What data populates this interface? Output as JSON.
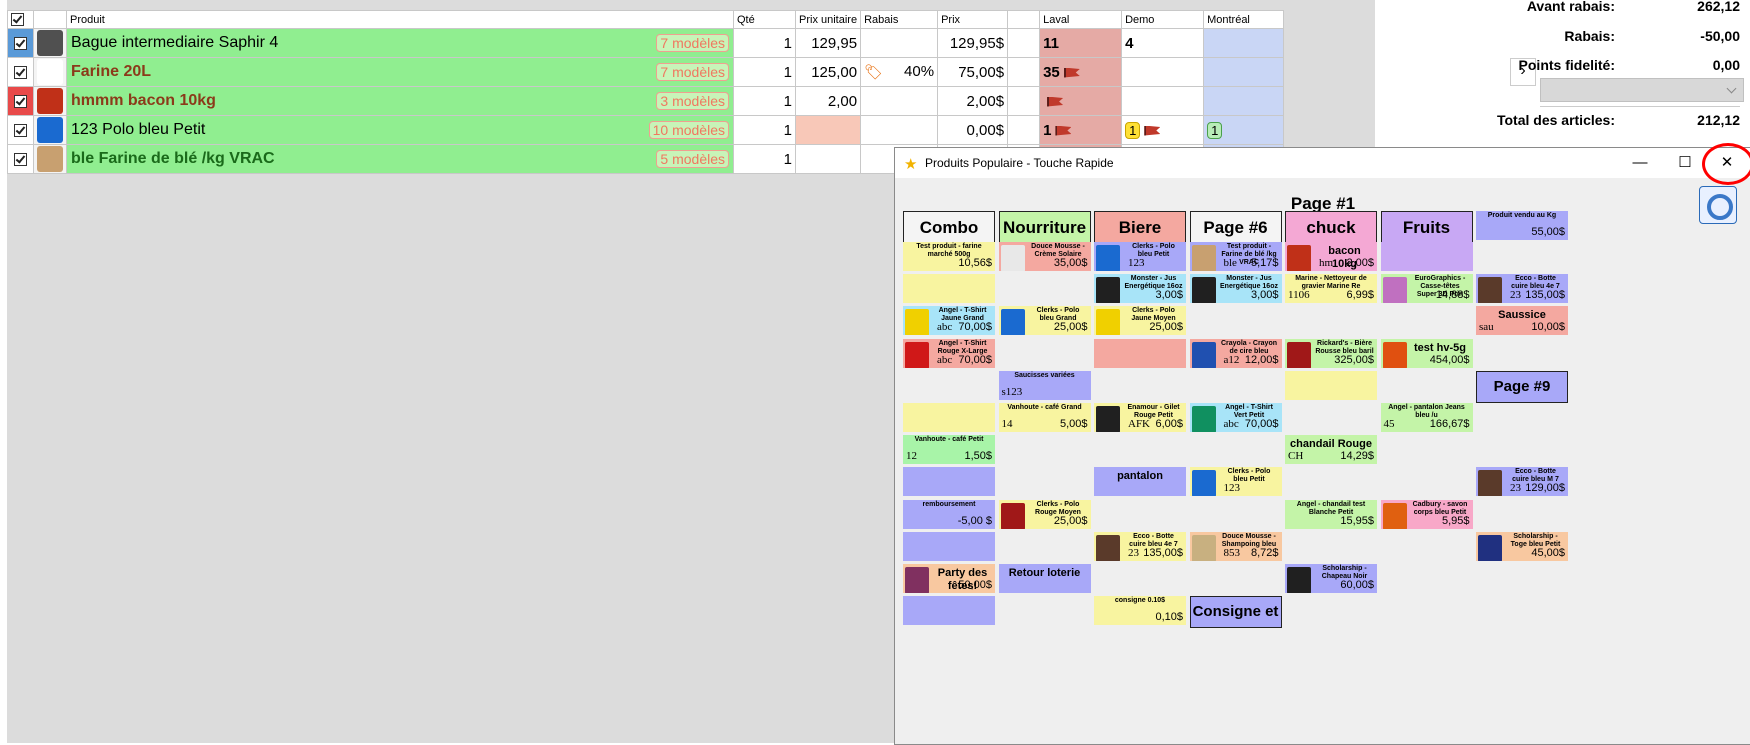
{
  "table": {
    "headers": {
      "produit": "Produit",
      "qte": "Qté",
      "prix_unitaire": "Prix unitaire",
      "rabais": "Rabais",
      "prix": "Prix",
      "laval": "Laval",
      "demo": "Demo",
      "montreal": "Montréal"
    },
    "rows": [
      {
        "name": "Bague intermediaire Saphir 4",
        "bold": false,
        "color": "#000000",
        "models": "7 modèles",
        "qty": "1",
        "unit": "129,95",
        "rabais": "",
        "prix": "129,95$",
        "laval": "11",
        "demo": "4",
        "montreal": ""
      },
      {
        "name": "Farine 20L",
        "bold": true,
        "color": "#8b3a1a",
        "models": "7 modèles",
        "qty": "1",
        "unit": "125,00",
        "rabais": "40%",
        "prix": "75,00$",
        "laval": "35",
        "demo": "",
        "montreal": ""
      },
      {
        "name": "hmmm bacon 10kg",
        "bold": true,
        "color": "#8b3a1a",
        "models": "3 modèles",
        "qty": "1",
        "unit": "2,00",
        "rabais": "",
        "prix": "2,00$",
        "laval": "",
        "demo": "",
        "montreal": ""
      },
      {
        "name": "123 Polo bleu Petit",
        "bold": false,
        "color": "#000000",
        "models": "10 modèles",
        "qty": "1",
        "unit": "",
        "rabais": "",
        "prix": "0,00$",
        "laval": "1",
        "demo": "1",
        "montreal": "1"
      },
      {
        "name": "ble Farine de blé /kg VRAC",
        "bold": true,
        "color": "#1a6a1a",
        "models": "5 modèles",
        "qty": "1",
        "unit": "",
        "rabais": "",
        "prix": "",
        "laval": "",
        "demo": "",
        "montreal": ""
      }
    ]
  },
  "totals": {
    "avant_rabais_label": "Avant rabais:",
    "avant_rabais": "262,12",
    "rabais_label": "Rabais:",
    "rabais": "-50,00",
    "points_label": "Points fidelité:",
    "points": "0,00",
    "total_label": "Total des articles:",
    "total": "212,12"
  },
  "popup": {
    "title": "Produits Populaire - Touche Rapide",
    "page": "Page #1",
    "headers": [
      "Combo",
      "Nourriture",
      "Biere",
      "Page #6",
      "chuck",
      "Fruits"
    ],
    "tiles": [
      {
        "col": 6,
        "row": 0,
        "name": "Produit vendu au Kg",
        "price": "55,00$",
        "color": "c-blu"
      },
      {
        "col": 0,
        "row": 1,
        "name": "Test produit - farine marché 500g",
        "price": "10,56$",
        "color": "c-yel"
      },
      {
        "col": 1,
        "row": 1,
        "name": "Douce Mousse - Crème Solaire",
        "price": "35,00$",
        "color": "c-pink",
        "img": "#e8e8e8"
      },
      {
        "col": 2,
        "row": 1,
        "name": "Clerks - Polo bleu Petit",
        "code": "123",
        "price": "",
        "color": "c-blu",
        "img": "#1a6ad0"
      },
      {
        "col": 3,
        "row": 1,
        "name": "Test produit - Farine de blé /kg VRAC",
        "code": "ble",
        "price": "5,17$",
        "color": "c-blu",
        "img": "#c8a070"
      },
      {
        "col": 4,
        "row": 1,
        "name": "bacon 10kg",
        "code": "hm",
        "price": "2,00$",
        "color": "c-mag",
        "img": "#c03018",
        "big": true
      },
      {
        "col": 5,
        "row": 1,
        "name": "",
        "price": "",
        "color": "c-pur"
      },
      {
        "col": 0,
        "row": 2,
        "name": "",
        "price": "",
        "color": "c-yel"
      },
      {
        "col": 2,
        "row": 2,
        "name": "Monster - Jus Energétique 16oz",
        "price": "3,00$",
        "color": "c-cyan",
        "img": "#202020"
      },
      {
        "col": 3,
        "row": 2,
        "name": "Monster - Jus Energétique 16oz",
        "price": "3,00$",
        "color": "c-cyan",
        "img": "#202020"
      },
      {
        "col": 4,
        "row": 2,
        "name": "Marine - Nettoyeur de gravier Marine Re",
        "code": "1106",
        "price": "6,99$",
        "color": "c-yel"
      },
      {
        "col": 5,
        "row": 2,
        "name": "EuroGraphics - Casse-têtes Super 3D Prin",
        "price": "14,88$",
        "color": "c-grn",
        "img": "#c070c0"
      },
      {
        "col": 6,
        "row": 2,
        "name": "Ecco - Botte cuire bleu 4e 7",
        "code": "23",
        "price": "135,00$",
        "color": "c-blu",
        "img": "#5a3a2a"
      },
      {
        "col": 0,
        "row": 3,
        "name": "Angel - T-Shirt Jaune Grand",
        "code": "abc",
        "price": "70,00$",
        "color": "c-cyan",
        "img": "#f0d000"
      },
      {
        "col": 1,
        "row": 3,
        "name": "Clerks - Polo bleu Grand",
        "price": "25,00$",
        "color": "c-yel",
        "img": "#1a6ad0"
      },
      {
        "col": 2,
        "row": 3,
        "name": "Clerks - Polo Jaune Moyen",
        "price": "25,00$",
        "color": "c-yel",
        "img": "#f0d000"
      },
      {
        "col": 6,
        "row": 3,
        "name": "Saussice",
        "code": "sau",
        "price": "10,00$",
        "color": "c-pink",
        "big": true
      },
      {
        "col": 0,
        "row": 4,
        "name": "Angel - T-Shirt Rouge X-Large",
        "code": "abc",
        "price": "70,00$",
        "color": "c-pink",
        "img": "#d01818"
      },
      {
        "col": 2,
        "row": 4,
        "name": "",
        "price": "",
        "color": "c-pink"
      },
      {
        "col": 3,
        "row": 4,
        "name": "Crayola - Crayon de cire bleu",
        "code": "a12",
        "price": "12,00$",
        "color": "c-pink",
        "img": "#2050b0"
      },
      {
        "col": 4,
        "row": 4,
        "name": "Rickard's - Bière Rousse bleu baril",
        "price": "325,00$",
        "color": "c-grn",
        "img": "#a01818"
      },
      {
        "col": 5,
        "row": 4,
        "name": "test hv-5g",
        "price": "454,00$",
        "color": "c-grn",
        "img": "#e05010",
        "big": true
      },
      {
        "col": 1,
        "row": 5,
        "name": "Saucisses variées",
        "code": "s123",
        "price": "",
        "color": "c-blu"
      },
      {
        "col": 4,
        "row": 5,
        "name": "",
        "price": "",
        "color": "c-yel"
      },
      {
        "col": 6,
        "row": 5,
        "name": "Page #9",
        "price": "",
        "color": "c-blu",
        "header": true
      },
      {
        "col": 0,
        "row": 6,
        "name": "",
        "price": "",
        "color": "c-yel"
      },
      {
        "col": 1,
        "row": 6,
        "name": "Vanhoute - café Grand",
        "code": "14",
        "price": "5,00$",
        "color": "c-yel"
      },
      {
        "col": 2,
        "row": 6,
        "name": "Enamour - Gilet Rouge Petit",
        "code": "AFK",
        "price": "6,00$",
        "color": "c-yel",
        "img": "#202020"
      },
      {
        "col": 3,
        "row": 6,
        "name": "Angel - T-Shirt Vert Petit",
        "code": "abc",
        "price": "70,00$",
        "color": "c-cyan",
        "img": "#109060"
      },
      {
        "col": 5,
        "row": 6,
        "name": "Angel - pantalon Jeans bleu /u",
        "code": "45",
        "price": "166,67$",
        "color": "c-grn"
      },
      {
        "col": 0,
        "row": 7,
        "name": "Vanhoute - café Petit",
        "code": "12",
        "price": "1,50$",
        "color": "c-lgrn"
      },
      {
        "col": 4,
        "row": 7,
        "name": "chandail Rouge",
        "code": "CH",
        "price": "14,29$",
        "color": "c-grn",
        "big": true
      },
      {
        "col": 0,
        "row": 8,
        "name": "",
        "price": "",
        "color": "c-blu"
      },
      {
        "col": 2,
        "row": 8,
        "name": "pantalon",
        "price": "",
        "color": "c-blu",
        "big": true
      },
      {
        "col": 3,
        "row": 8,
        "name": "Clerks - Polo bleu Petit",
        "code": "123",
        "price": "",
        "color": "c-yel",
        "img": "#1a6ad0"
      },
      {
        "col": 6,
        "row": 8,
        "name": "Ecco - Botte cuire bleu M 7",
        "code": "23",
        "price": "129,00$",
        "color": "c-blu",
        "img": "#5a3a2a"
      },
      {
        "col": 0,
        "row": 9,
        "name": "remboursement",
        "price": "-5,00 $",
        "color": "c-blu"
      },
      {
        "col": 1,
        "row": 9,
        "name": "Clerks - Polo Rouge Moyen",
        "price": "25,00$",
        "color": "c-yel",
        "img": "#a01818"
      },
      {
        "col": 4,
        "row": 9,
        "name": "Angel - chandail test Blanche Petit",
        "price": "15,95$",
        "color": "c-grn"
      },
      {
        "col": 5,
        "row": 9,
        "name": "Cadbury - savon corps bleu Petit",
        "price": "5,95$",
        "color": "c-lpnk",
        "img": "#e06010"
      },
      {
        "col": 0,
        "row": 10,
        "name": "",
        "price": "",
        "color": "c-blu"
      },
      {
        "col": 2,
        "row": 10,
        "name": "Ecco - Botte cuire bleu 4e 7",
        "code": "23",
        "price": "135,00$",
        "color": "c-yel",
        "img": "#5a3a2a"
      },
      {
        "col": 3,
        "row": 10,
        "name": "Douce Mousse - Shampoing bleu",
        "code": "853",
        "price": "8,72$",
        "color": "c-org",
        "img": "#c8b080"
      },
      {
        "col": 6,
        "row": 10,
        "name": "Scholarship - Toge bleu Petit",
        "price": "45,00$",
        "color": "c-org",
        "img": "#203080"
      },
      {
        "col": 0,
        "row": 11,
        "name": "Party des fêtes!",
        "price": "50,00$",
        "color": "c-org",
        "img": "#803060",
        "big": true
      },
      {
        "col": 1,
        "row": 11,
        "name": "Retour loterie",
        "price": "",
        "color": "c-blu",
        "big": true
      },
      {
        "col": 4,
        "row": 11,
        "name": "Scholarship - Chapeau Noir",
        "price": "60,00$",
        "color": "c-blu",
        "img": "#202020"
      },
      {
        "col": 0,
        "row": 12,
        "name": "",
        "price": "",
        "color": "c-blu"
      },
      {
        "col": 2,
        "row": 12,
        "name": "consigne 0.10$",
        "price": "0,10$",
        "color": "c-yel"
      },
      {
        "col": 3,
        "row": 12,
        "name": "Consigne et retour",
        "price": "",
        "color": "c-blu",
        "header": true
      }
    ]
  }
}
